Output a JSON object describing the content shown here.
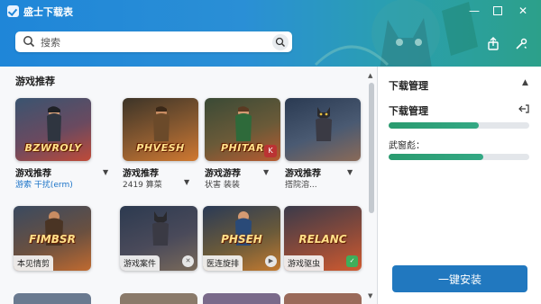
{
  "window": {
    "title": "盛士下载表",
    "minimize": "—",
    "close": "✕"
  },
  "search": {
    "placeholder": "搜索"
  },
  "colors": {
    "accent": "#2178bf",
    "progress": "#2a9b6f",
    "header_start": "#1f86d8",
    "header_end": "#2ca08a"
  },
  "recommend": {
    "title": "游戏推荐",
    "row1": [
      {
        "art_text": "BZWROLY",
        "title": "游戏推荐",
        "sub": "游索 干扰(erm)",
        "sub_blue": true
      },
      {
        "art_text": "PHVESH",
        "title": "游戏推荐",
        "sub": "2419 算菜",
        "sub_blue": false
      },
      {
        "art_text": "PHITAR",
        "title": "游戏游荐",
        "sub": "状害 装装",
        "sub_blue": false
      },
      {
        "art_text": "",
        "title": "游戏推荐",
        "sub": "搭院溶...",
        "sub_blue": false
      }
    ],
    "row2": [
      {
        "art_text": "FIMBSR",
        "label": "本见情剪"
      },
      {
        "art_text": "",
        "label": "游戏案件"
      },
      {
        "art_text": "PHSEH",
        "label": "医连旋排"
      },
      {
        "art_text": "RELANC",
        "label": "游戏驱虫"
      }
    ]
  },
  "downloads": {
    "title": "下载管理",
    "subtitle": "下载管理",
    "progress1": 0.64,
    "label2": "武窗彪：",
    "progress2": 0.67,
    "install_label": "一键安装"
  },
  "icons": [
    "app-logo-icon",
    "search-icon",
    "minimize-icon",
    "maximize-icon",
    "close-icon",
    "share-icon",
    "settings-icon",
    "chevron-down-icon",
    "link-icon"
  ]
}
